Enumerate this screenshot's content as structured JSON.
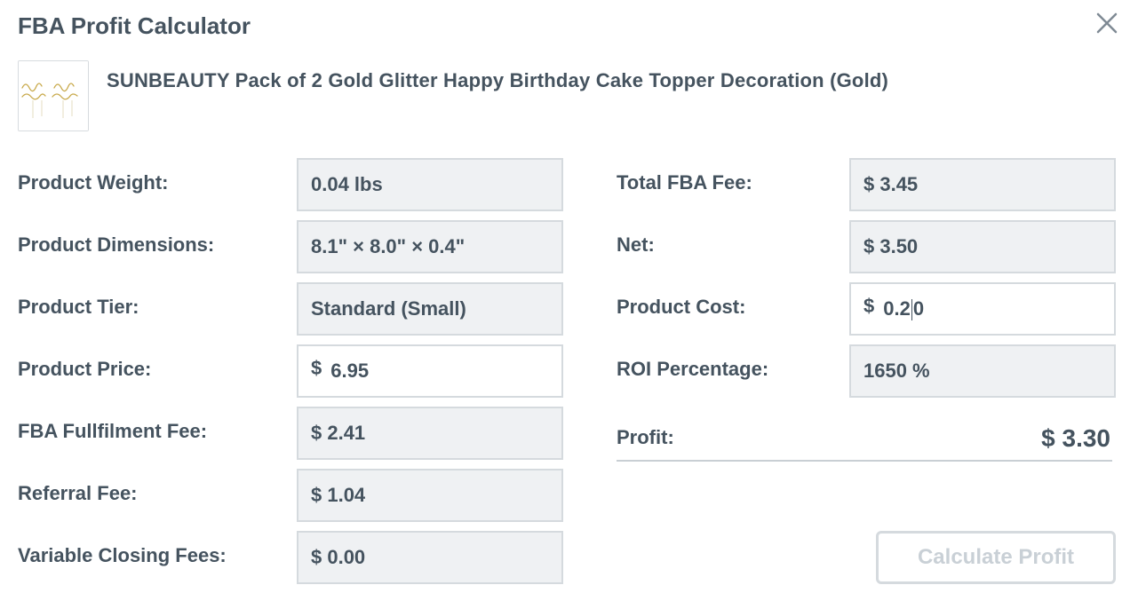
{
  "dialog": {
    "title": "FBA Profit Calculator"
  },
  "product": {
    "name": "SUNBEAUTY Pack of 2 Gold Glitter Happy Birthday Cake Topper Decoration (Gold)",
    "thumbnail_text": "Happy Birthday"
  },
  "left_fields": {
    "weight": {
      "label": "Product Weight:",
      "value": "0.04 lbs"
    },
    "dimensions": {
      "label": "Product Dimensions:",
      "value": "8.1\" × 8.0\" × 0.4\""
    },
    "tier": {
      "label": "Product Tier:",
      "value": "Standard (Small)"
    },
    "price": {
      "label": "Product Price:",
      "currency": "$",
      "value": "6.95"
    },
    "fulfilment_fee": {
      "label": "FBA Fullfilment Fee:",
      "value": "$ 2.41"
    },
    "referral_fee": {
      "label": "Referral Fee:",
      "value": "$ 1.04"
    },
    "closing_fees": {
      "label": "Variable Closing Fees:",
      "value": "$ 0.00"
    }
  },
  "right_fields": {
    "total_fee": {
      "label": "Total FBA Fee:",
      "value": "$ 3.45"
    },
    "net": {
      "label": "Net:",
      "value": "$ 3.50"
    },
    "cost": {
      "label": "Product Cost:",
      "currency": "$",
      "value_before_caret": "0.2",
      "value_after_caret": "0"
    },
    "roi": {
      "label": "ROI Percentage:",
      "value": "1650 %"
    }
  },
  "profit": {
    "label": "Profit:",
    "value": "$ 3.30"
  },
  "actions": {
    "calculate_label": "Calculate Profit"
  },
  "colors": {
    "text": "#45535f",
    "field_bg": "#eff1f3",
    "field_border": "#d5dade",
    "button_text_disabled": "#c9d0d6",
    "gold": "#c8a94a"
  }
}
